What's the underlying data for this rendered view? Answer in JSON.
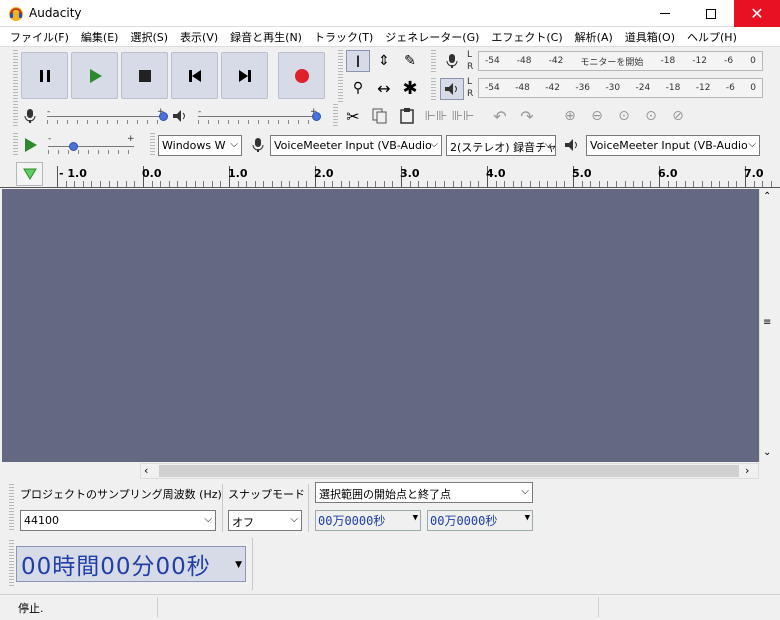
{
  "window": {
    "title": "Audacity"
  },
  "menu": [
    "ファイル(F)",
    "編集(E)",
    "選択(S)",
    "表示(V)",
    "録音と再生(N)",
    "トラック(T)",
    "ジェネレーター(G)",
    "エフェクト(C)",
    "解析(A)",
    "道具箱(O)",
    "ヘルプ(H)"
  ],
  "meters": {
    "record_ticks": [
      "-54",
      "-48",
      "-42",
      "モニターを開始",
      "-18",
      "-12",
      "-6",
      "0"
    ],
    "play_ticks": [
      "-54",
      "-48",
      "-42",
      "-36",
      "-30",
      "-24",
      "-18",
      "-12",
      "-6",
      "0"
    ],
    "left": "L",
    "right": "R"
  },
  "mixer": {
    "minus": "-",
    "plus": "+",
    "record_volume": 1.0,
    "playback_volume": 1.0,
    "play_speed": 0.3
  },
  "devices": {
    "host": "Windows W",
    "input": "VoiceMeeter Input (VB-Audio",
    "channels": "2(ステレオ) 録音チャ",
    "output": "VoiceMeeter Input (VB-Audio"
  },
  "ruler": [
    "- 1.0",
    "0.0",
    "1.0",
    "2.0",
    "3.0",
    "4.0",
    "5.0",
    "6.0",
    "7.0"
  ],
  "selection": {
    "rate_label": "プロジェクトのサンプリング周波数 (Hz)",
    "rate_value": "44100",
    "snap_label": "スナップモード",
    "snap_value": "オフ",
    "range_mode": "選択範囲の開始点と終了点",
    "start": "00万0000秒",
    "end": "00万0000秒"
  },
  "time_display": "00時間00分00秒",
  "status": "停止."
}
